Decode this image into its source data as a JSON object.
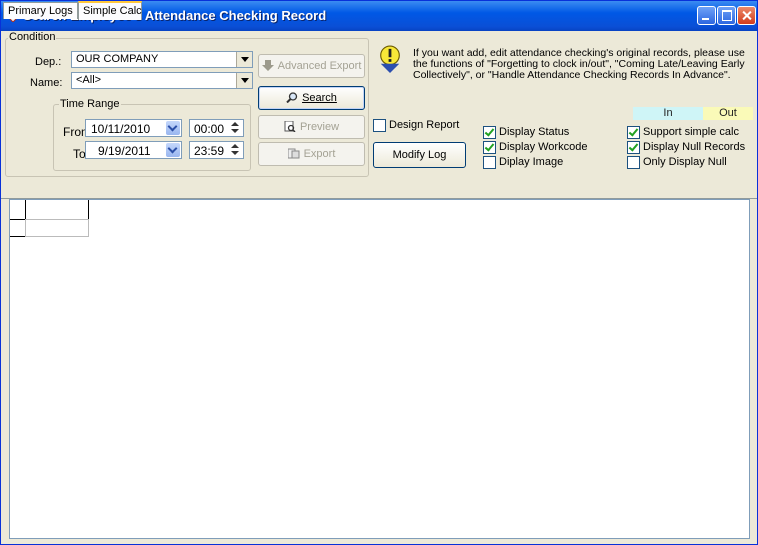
{
  "window": {
    "title": "Search Employee's Attendance Checking Record"
  },
  "condition": {
    "legend": "Condition",
    "dep_label": "Dep.:",
    "dep_value": "OUR COMPANY",
    "name_label": "Name:",
    "name_value": "<All>",
    "time_range": {
      "legend": "Time Range",
      "from_label": "From",
      "from_date": "10/11/2010",
      "from_time": "00:00",
      "to_label": "To",
      "to_date": "9/19/2011",
      "to_time": "23:59"
    }
  },
  "buttons": {
    "advanced_export": "Advanced Export",
    "search": "Search",
    "preview": "Preview",
    "export": "Export",
    "modify_log": "Modify Log"
  },
  "info_text": "If you want add, edit attendance checking's original records, please use the functions of \"Forgetting to clock in/out\", \"Coming Late/Leaving Early Collectively\", or \"Handle Attendance Checking Records In Advance\".",
  "legend_colors": {
    "in_label": "In",
    "in_color": "#cff5f7",
    "out_label": "Out",
    "out_color": "#fafab8"
  },
  "checkboxes": {
    "design_report": {
      "label": "Design Report",
      "checked": false
    },
    "display_status": {
      "label": "Display Status",
      "checked": true
    },
    "display_workcode": {
      "label": "Display Workcode",
      "checked": true
    },
    "diplay_image": {
      "label": "Diplay Image",
      "checked": false
    },
    "support_simple_calc": {
      "label": "Support simple calc",
      "checked": true
    },
    "display_null_records": {
      "label": "Display Null Records",
      "checked": true
    },
    "only_display_null": {
      "label": "Only Display Null",
      "checked": false
    }
  },
  "tabs": [
    {
      "label": "Primary Logs",
      "selected": false
    },
    {
      "label": "Simple Calc",
      "selected": true
    }
  ]
}
